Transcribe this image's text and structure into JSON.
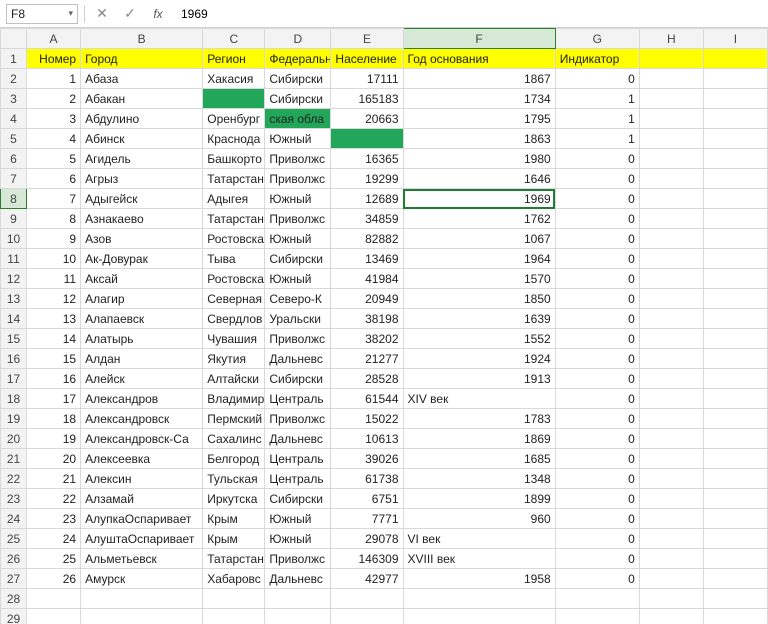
{
  "name_box": {
    "value": "F8"
  },
  "formula_bar": {
    "value": "1969"
  },
  "columns": [
    "A",
    "B",
    "C",
    "D",
    "E",
    "F",
    "G",
    "H",
    "I"
  ],
  "active_cell": {
    "row": 8,
    "col": "F"
  },
  "headers": {
    "A": "Номер",
    "B": "Город",
    "C": "Регион",
    "D": "Федеральн",
    "E": "Население",
    "F": "Год основания",
    "G": "Индикатор",
    "H": "",
    "I": ""
  },
  "rows": [
    {
      "n": 1,
      "city": "Абаза",
      "region": "Хакасия",
      "fed": "Сибирски",
      "pop": "17111",
      "year": "1867",
      "ind": "0",
      "region_green": false,
      "fed_green": false,
      "pop_green": false
    },
    {
      "n": 2,
      "city": "Абакан",
      "region": "",
      "fed": "Сибирски",
      "pop": "165183",
      "year": "1734",
      "ind": "1",
      "region_green": true,
      "fed_green": false,
      "pop_green": false
    },
    {
      "n": 3,
      "city": "Абдулино",
      "region": "Оренбург",
      "fed": "ская обла",
      "pop": "20663",
      "year": "1795",
      "ind": "1",
      "region_green": false,
      "fed_green": true,
      "pop_green": false
    },
    {
      "n": 4,
      "city": "Абинск",
      "region": "Краснода",
      "fed": "Южный",
      "pop": "",
      "year": "1863",
      "ind": "1",
      "region_green": false,
      "fed_green": false,
      "pop_green": true
    },
    {
      "n": 5,
      "city": "Агидель",
      "region": "Башкорто",
      "fed": "Приволжс",
      "pop": "16365",
      "year": "1980",
      "ind": "0",
      "region_green": false,
      "fed_green": false,
      "pop_green": false
    },
    {
      "n": 6,
      "city": "Агрыз",
      "region": "Татарстан",
      "fed": "Приволжс",
      "pop": "19299",
      "year": "1646",
      "ind": "0",
      "region_green": false,
      "fed_green": false,
      "pop_green": false
    },
    {
      "n": 7,
      "city": "Адыгейск",
      "region": "Адыгея",
      "fed": "Южный",
      "pop": "12689",
      "year": "1969",
      "ind": "0",
      "region_green": false,
      "fed_green": false,
      "pop_green": false
    },
    {
      "n": 8,
      "city": "Азнакаево",
      "region": "Татарстан",
      "fed": "Приволжс",
      "pop": "34859",
      "year": "1762",
      "ind": "0",
      "region_green": false,
      "fed_green": false,
      "pop_green": false
    },
    {
      "n": 9,
      "city": "Азов",
      "region": "Ростовска",
      "fed": "Южный",
      "pop": "82882",
      "year": "1067",
      "ind": "0",
      "region_green": false,
      "fed_green": false,
      "pop_green": false
    },
    {
      "n": 10,
      "city": "Ак-Довурак",
      "region": "Тыва",
      "fed": "Сибирски",
      "pop": "13469",
      "year": "1964",
      "ind": "0",
      "region_green": false,
      "fed_green": false,
      "pop_green": false
    },
    {
      "n": 11,
      "city": "Аксай",
      "region": "Ростовска",
      "fed": "Южный",
      "pop": "41984",
      "year": "1570",
      "ind": "0",
      "region_green": false,
      "fed_green": false,
      "pop_green": false
    },
    {
      "n": 12,
      "city": "Алагир",
      "region": "Северная",
      "fed": "Северо-К",
      "pop": "20949",
      "year": "1850",
      "ind": "0",
      "region_green": false,
      "fed_green": false,
      "pop_green": false
    },
    {
      "n": 13,
      "city": "Алапаевск",
      "region": "Свердлов",
      "fed": "Уральски",
      "pop": "38198",
      "year": "1639",
      "ind": "0",
      "region_green": false,
      "fed_green": false,
      "pop_green": false
    },
    {
      "n": 14,
      "city": "Алатырь",
      "region": "Чувашия",
      "fed": "Приволжс",
      "pop": "38202",
      "year": "1552",
      "ind": "0",
      "region_green": false,
      "fed_green": false,
      "pop_green": false
    },
    {
      "n": 15,
      "city": "Алдан",
      "region": "Якутия",
      "fed": "Дальневс",
      "pop": "21277",
      "year": "1924",
      "ind": "0",
      "region_green": false,
      "fed_green": false,
      "pop_green": false
    },
    {
      "n": 16,
      "city": "Алейск",
      "region": "Алтайски",
      "fed": "Сибирски",
      "pop": "28528",
      "year": "1913",
      "ind": "0",
      "region_green": false,
      "fed_green": false,
      "pop_green": false
    },
    {
      "n": 17,
      "city": "Александров",
      "region": "Владимир",
      "fed": "Централь",
      "pop": "61544",
      "year": "XIV век",
      "ind": "0",
      "region_green": false,
      "fed_green": false,
      "pop_green": false
    },
    {
      "n": 18,
      "city": "Александровск",
      "region": "Пермский",
      "fed": "Приволжс",
      "pop": "15022",
      "year": "1783",
      "ind": "0",
      "region_green": false,
      "fed_green": false,
      "pop_green": false
    },
    {
      "n": 19,
      "city": "Александровск-Са",
      "region": "Сахалинс",
      "fed": "Дальневс",
      "pop": "10613",
      "year": "1869",
      "ind": "0",
      "region_green": false,
      "fed_green": false,
      "pop_green": false
    },
    {
      "n": 20,
      "city": "Алексеевка",
      "region": "Белгород",
      "fed": "Централь",
      "pop": "39026",
      "year": "1685",
      "ind": "0",
      "region_green": false,
      "fed_green": false,
      "pop_green": false
    },
    {
      "n": 21,
      "city": "Алексин",
      "region": "Тульская",
      "fed": "Централь",
      "pop": "61738",
      "year": "1348",
      "ind": "0",
      "region_green": false,
      "fed_green": false,
      "pop_green": false
    },
    {
      "n": 22,
      "city": "Алзамай",
      "region": "Иркутска",
      "fed": "Сибирски",
      "pop": "6751",
      "year": "1899",
      "ind": "0",
      "region_green": false,
      "fed_green": false,
      "pop_green": false
    },
    {
      "n": 23,
      "city": "АлупкаОспаривает",
      "region": "Крым",
      "fed": "Южный",
      "pop": "7771",
      "year": "960",
      "ind": "0",
      "region_green": false,
      "fed_green": false,
      "pop_green": false
    },
    {
      "n": 24,
      "city": "АлуштаОспаривает",
      "region": "Крым",
      "fed": "Южный",
      "pop": "29078",
      "year": "VI век",
      "ind": "0",
      "region_green": false,
      "fed_green": false,
      "pop_green": false
    },
    {
      "n": 25,
      "city": "Альметьевск",
      "region": "Татарстан",
      "fed": "Приволжс",
      "pop": "146309",
      "year": "XVIII век",
      "ind": "0",
      "region_green": false,
      "fed_green": false,
      "pop_green": false
    },
    {
      "n": 26,
      "city": "Амурск",
      "region": "Хабаровс",
      "fed": "Дальневс",
      "pop": "42977",
      "year": "1958",
      "ind": "0",
      "region_green": false,
      "fed_green": false,
      "pop_green": false
    }
  ],
  "chart_data": {
    "type": "table",
    "title": "",
    "columns": [
      "Номер",
      "Город",
      "Регион",
      "Федеральн",
      "Население",
      "Год основания",
      "Индикатор"
    ]
  }
}
